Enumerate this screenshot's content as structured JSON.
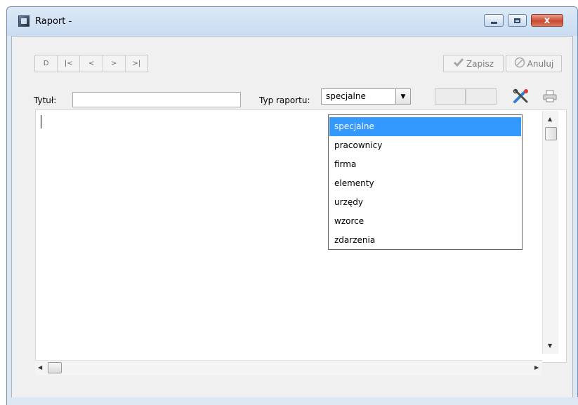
{
  "window": {
    "title": "Raport -",
    "close_glyph": "x"
  },
  "toolbar": {
    "nav": [
      "D",
      "|<",
      "<",
      ">",
      ">|"
    ],
    "save_label": "Zapisz",
    "cancel_label": "Anuluj",
    "save_icon": "check-icon",
    "cancel_icon": "cancel-icon"
  },
  "form": {
    "title_label": "Tytuł:",
    "title_value": "",
    "report_type_label": "Typ raportu:",
    "report_type_value": "specjalne"
  },
  "dropdown": {
    "options": [
      "specjalne",
      "pracownicy",
      "firma",
      "elementy",
      "urzędy",
      "wzorce",
      "zdarzenia"
    ],
    "selected_index": 0
  },
  "colors": {
    "selection": "#3399ff",
    "close": "#c94a30"
  }
}
